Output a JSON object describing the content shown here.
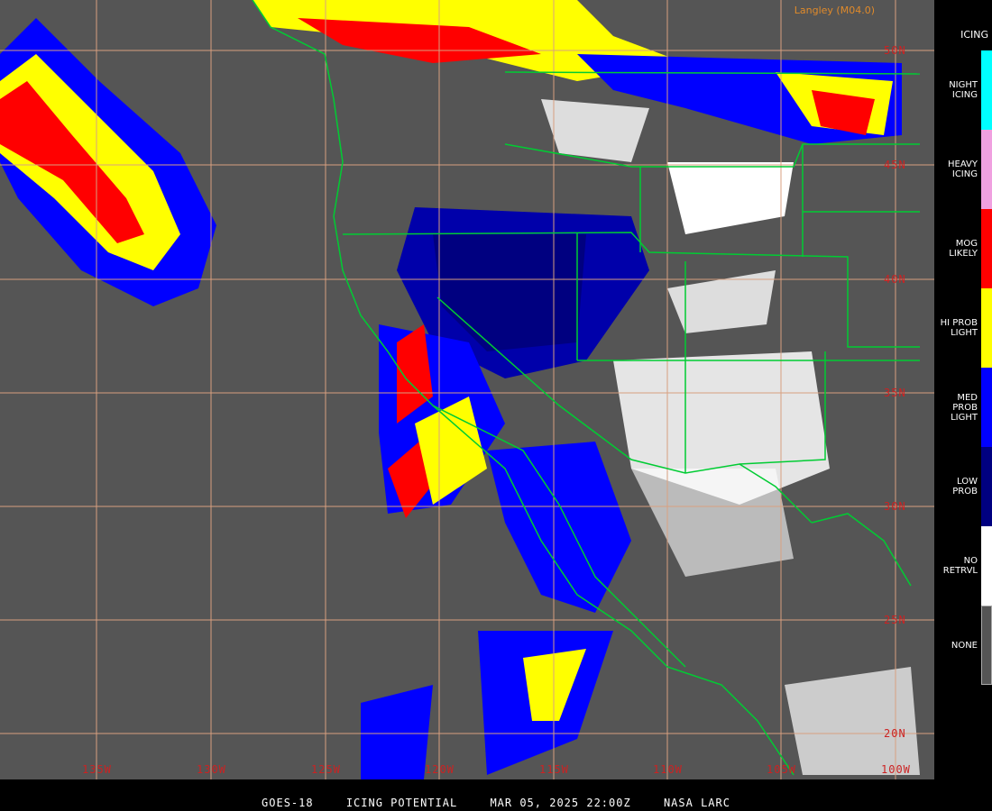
{
  "credit": "Langley (M04.0)",
  "legend": {
    "title": "ICING",
    "items": [
      {
        "label": "NIGHT\nICING",
        "color": "#00ffff"
      },
      {
        "label": "HEAVY\nICING",
        "color": "#f0a0e0"
      },
      {
        "label": "MOG\nLIKELY",
        "color": "#ff0000"
      },
      {
        "label": "HI PROB\nLIGHT",
        "color": "#ffff00"
      },
      {
        "label": "MED PROB\nLIGHT",
        "color": "#0000ff"
      },
      {
        "label": "LOW\nPROB",
        "color": "#000080"
      },
      {
        "label": "NO\nRETRVL",
        "color": "#ffffff"
      },
      {
        "label": "NONE",
        "color": "#555555"
      }
    ]
  },
  "latitude_labels": [
    "50N",
    "45N",
    "40N",
    "35N",
    "30N",
    "25N",
    "20N"
  ],
  "longitude_labels": [
    "135W",
    "130W",
    "125W",
    "120W",
    "115W",
    "110W",
    "105W",
    "100W"
  ],
  "footer": {
    "satellite": "GOES-18",
    "product": "ICING POTENTIAL",
    "datetime": "MAR 05, 2025 22:00Z",
    "agency": "NASA LARC"
  }
}
